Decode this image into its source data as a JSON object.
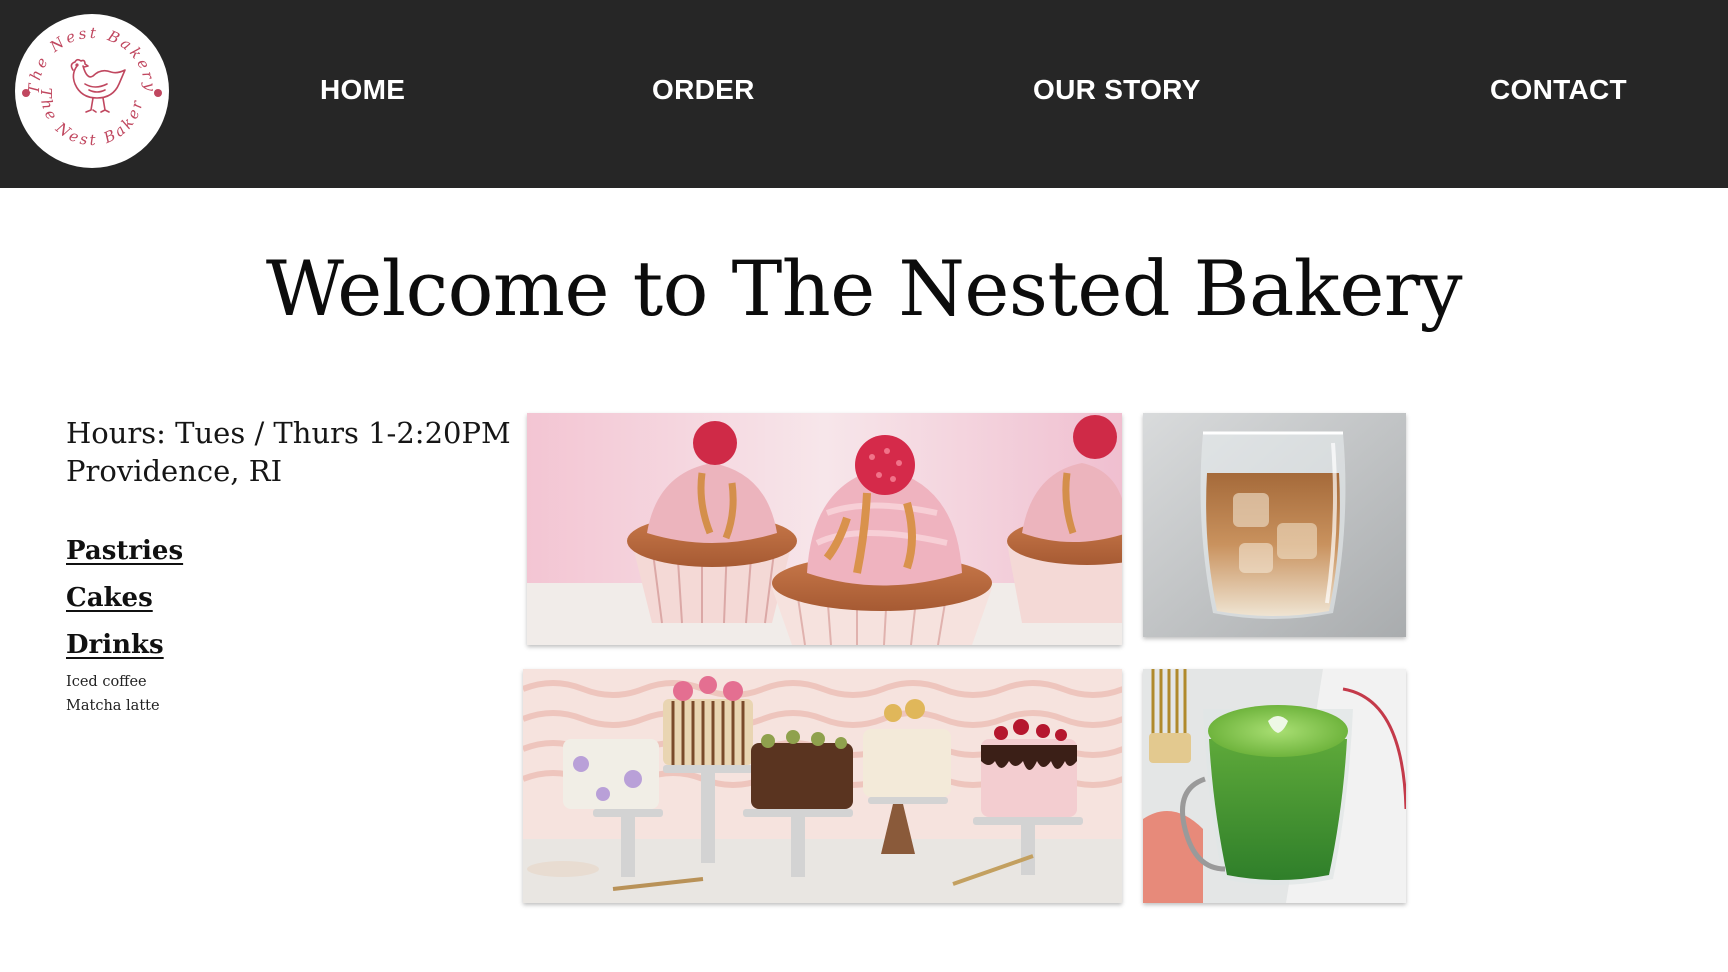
{
  "logo": {
    "text_top": "The Nest Bakery",
    "text_bottom": "The Nest Bakery",
    "icon": "hen-icon",
    "color": "#c0475f"
  },
  "nav": {
    "items": [
      {
        "label": "HOME"
      },
      {
        "label": "ORDER"
      },
      {
        "label": "OUR STORY"
      },
      {
        "label": "CONTACT"
      }
    ],
    "background": "#262626"
  },
  "main": {
    "title": "Welcome to The Nested Bakery",
    "hours": "Hours: Tues / Thurs 1-2:20PM",
    "location": "Providence, RI",
    "menu": [
      {
        "label": "Pastries"
      },
      {
        "label": "Cakes"
      },
      {
        "label": "Drinks"
      }
    ],
    "drinks": [
      "Iced coffee",
      "Matcha latte"
    ]
  },
  "photos": [
    {
      "name": "cupcakes-photo"
    },
    {
      "name": "iced-coffee-photo"
    },
    {
      "name": "cakes-photo"
    },
    {
      "name": "matcha-latte-photo"
    }
  ]
}
